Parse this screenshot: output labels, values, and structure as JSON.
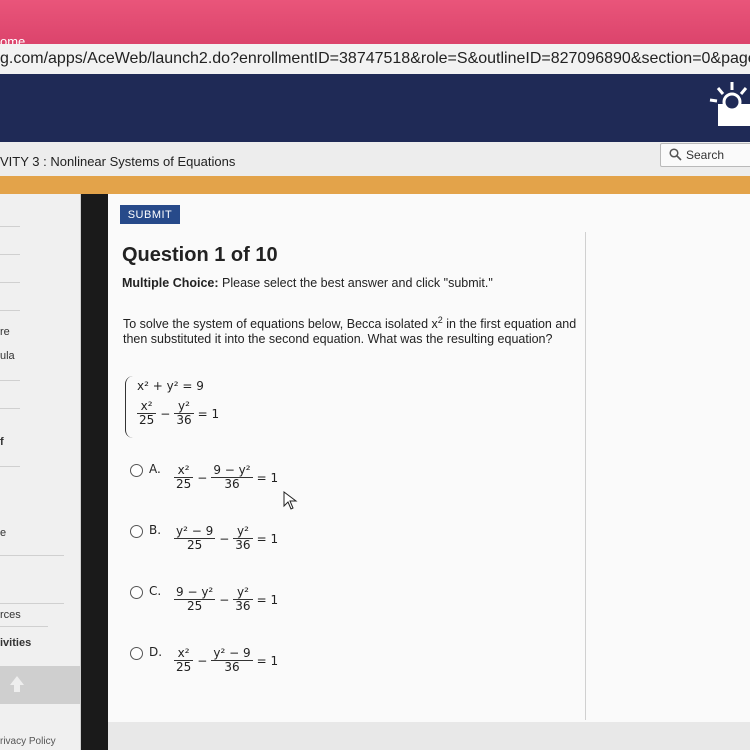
{
  "browser": {
    "tab_label": "ome",
    "url": "g.com/apps/AceWeb/launch2.do?enrollmentID=38747518&role=S&outlineID=827096890&section=0&page=2"
  },
  "header": {
    "activity_title": "VITY 3 : Nonlinear Systems of Equations",
    "search_label": "Search",
    "icons": [
      "search-icon",
      "logo-icon"
    ]
  },
  "sidebar": {
    "items": [
      "re",
      "ula",
      "f",
      "e",
      "rces",
      "ivities"
    ],
    "privacy": "rivacy Policy"
  },
  "question": {
    "submit_label": "SUBMIT",
    "title": "Question 1 of 10",
    "instruction_bold": "Multiple Choice:",
    "instruction_text": " Please select the best answer and click \"submit.\"",
    "prompt_1": "To solve the system of equations below, Becca isolated x",
    "prompt_sup": "2",
    "prompt_2": " in the first equation and then substituted it into the second equation. What was the resulting equation?",
    "system": {
      "eq1": "x² + y² = 9",
      "eq2_num1": "x²",
      "eq2_den1": "25",
      "eq2_op": "−",
      "eq2_num2": "y²",
      "eq2_den2": "36",
      "eq2_rhs": "= 1"
    },
    "options": [
      {
        "letter": "A.",
        "num1": "x²",
        "den1": "25",
        "op": "−",
        "num2": "9 − y²",
        "den2": "36",
        "rhs": "= 1"
      },
      {
        "letter": "B.",
        "num1": "y² − 9",
        "den1": "25",
        "op": "−",
        "num2": "y²",
        "den2": "36",
        "rhs": "= 1"
      },
      {
        "letter": "C.",
        "num1": "9 − y²",
        "den1": "25",
        "op": "−",
        "num2": "y²",
        "den2": "36",
        "rhs": "= 1"
      },
      {
        "letter": "D.",
        "num1": "x²",
        "den1": "25",
        "op": "−",
        "num2": "y² − 9",
        "den2": "36",
        "rhs": "= 1"
      }
    ]
  }
}
